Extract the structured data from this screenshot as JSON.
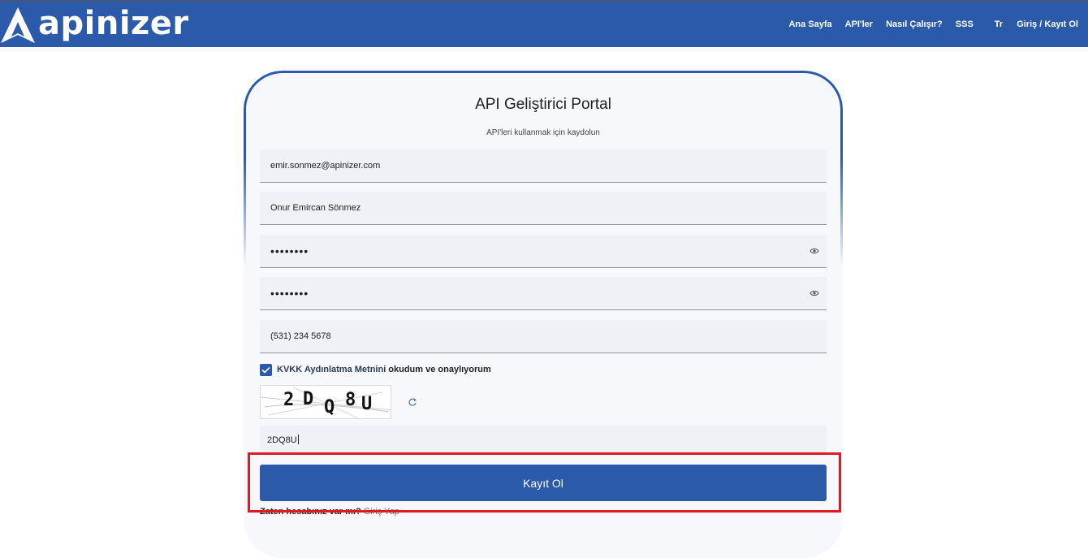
{
  "header": {
    "brand": "apinizer",
    "nav": [
      {
        "id": "home",
        "label": "Ana Sayfa"
      },
      {
        "id": "apis",
        "label": "API'ler"
      },
      {
        "id": "how",
        "label": "Nasıl Çalışır?"
      },
      {
        "id": "faq",
        "label": "SSS"
      }
    ],
    "language": "Tr",
    "auth": "Giriş  / Kayıt Ol"
  },
  "form": {
    "title": "API Geliştirici Portal",
    "subtitle": "API'leri kullanmak için kaydolun",
    "email": "emir.sonmez@apinizer.com",
    "full_name": "Onur Emircan Sönmez",
    "password": "••••••••",
    "password_confirm": "••••••••",
    "phone": "(531) 234 5678",
    "kvkk_link": "KVKK Aydınlatma Metnini",
    "kvkk_rest": "okudum ve onaylıyorum",
    "kvkk_checked": true,
    "captcha_image_text": "2DQ8U",
    "captcha_input": "2DQ8U",
    "submit_label": "Kayıt Ol",
    "already_text": "Zaten hesabınız var mı?",
    "login_link": "Giriş Yap"
  },
  "icons": {
    "password_toggle": "eye-icon",
    "captcha_refresh": "refresh-icon",
    "checkbox": "checkmark-icon"
  },
  "colors": {
    "primary": "#2a5aa9",
    "highlight": "#e01a22",
    "field_bg": "#eff1f6"
  }
}
